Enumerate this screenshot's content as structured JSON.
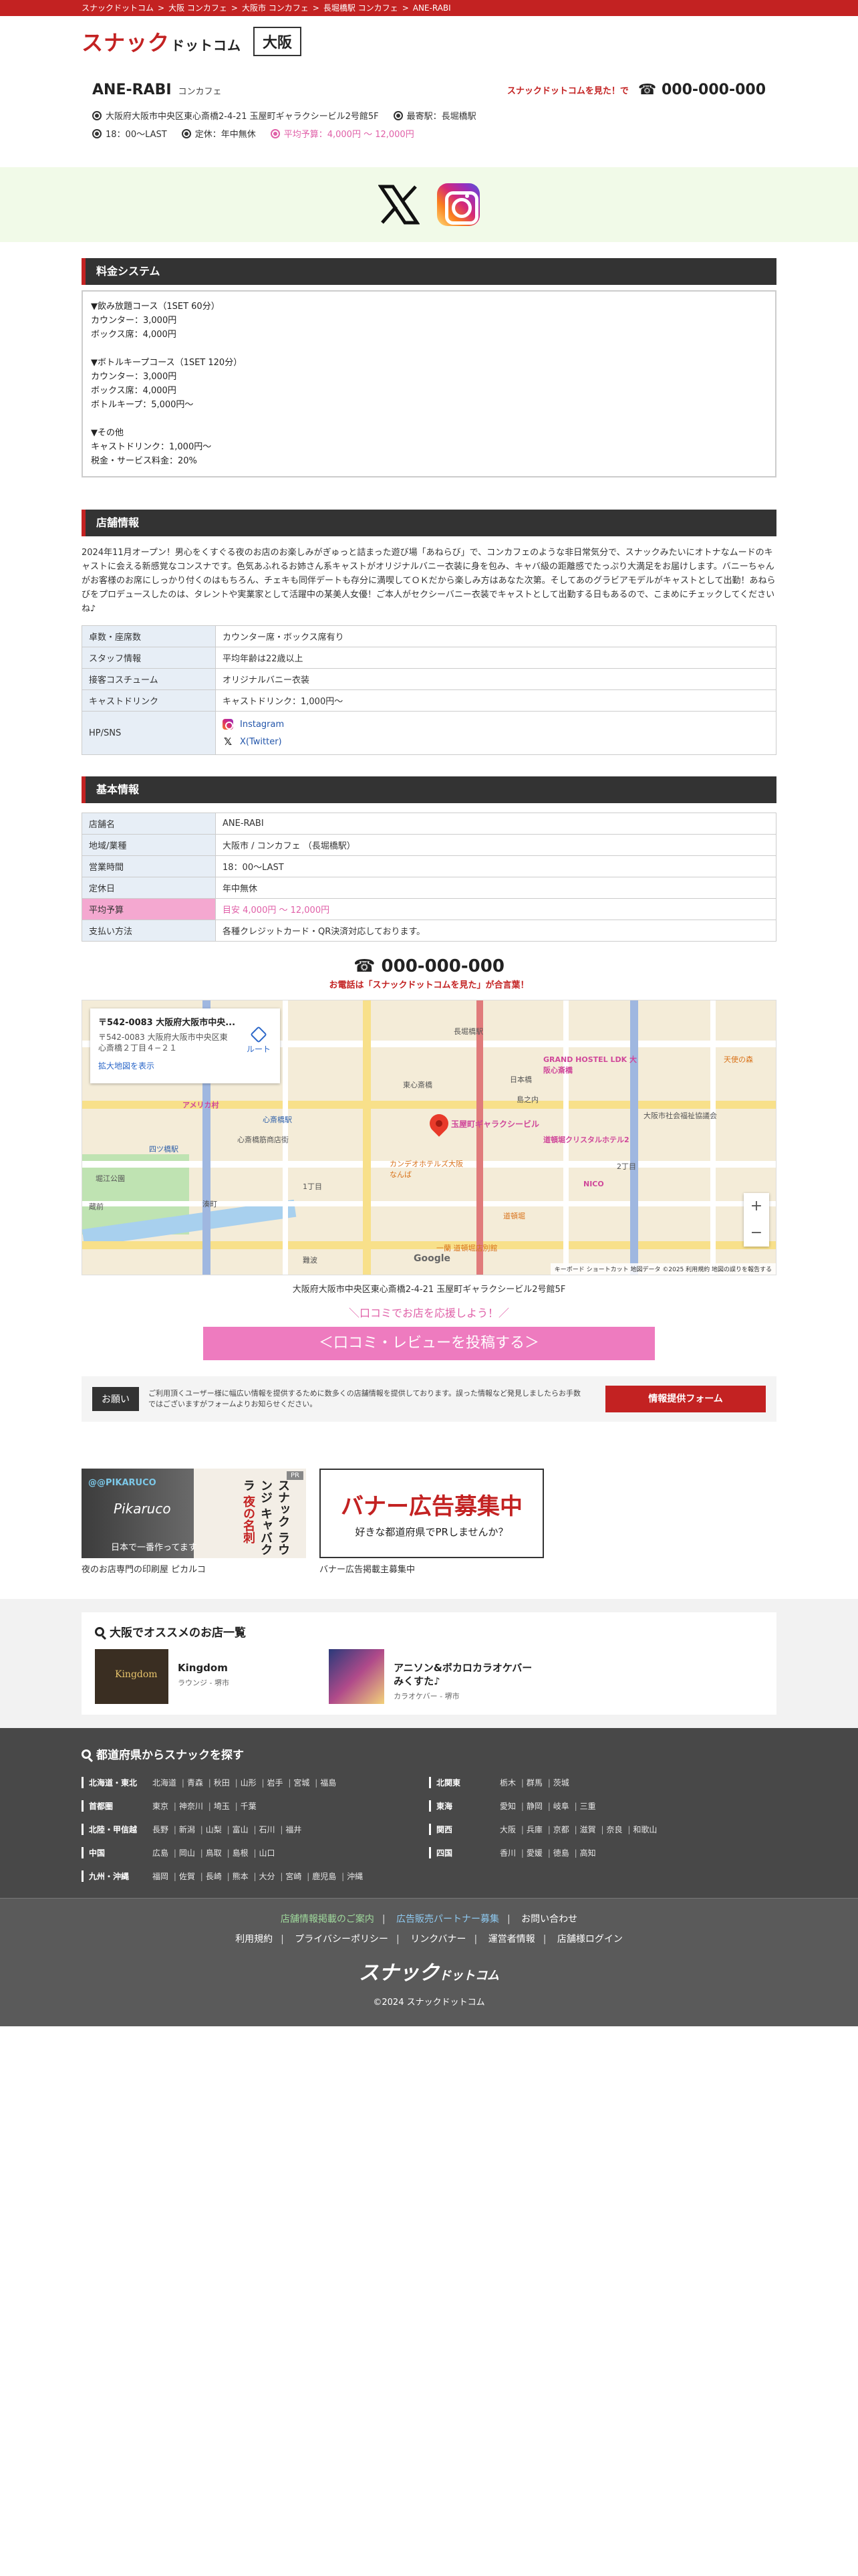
{
  "breadcrumb": [
    "スナックドットコム",
    ">",
    "大阪 コンカフェ",
    ">",
    "大阪市 コンカフェ",
    ">",
    "長堀橋駅 コンカフェ",
    ">",
    "ANE-RABI"
  ],
  "header": {
    "logo_main": "スナック",
    "logo_sub": "ドットコム",
    "area": "大阪"
  },
  "store": {
    "name": "ANE-RABI",
    "genre": "コンカフェ",
    "tel_note": "スナックドットコムを見た！で",
    "tel": "☎ 000-000-000",
    "address": "大阪府大阪市中央区東心斎橋2-4-21 玉屋町ギャラクシービル2号館5F",
    "station": "最寄駅：長堀橋駅",
    "hours": "18：00〜LAST",
    "holiday": "定休：年中無休",
    "budget": "平均予算：4,000円 〜 12,000円"
  },
  "sns": {
    "x_icon": "x-logo-icon",
    "ig_icon": "instagram-logo-icon"
  },
  "price": {
    "title": "料金システム",
    "text": "▼飲み放題コース（1SET 60分）\nカウンター：3,000円\nボックス席：4,000円\n\n▼ボトルキープコース（1SET 120分）\nカウンター：3,000円\nボックス席：4,000円\nボトルキープ：5,000円〜\n\n▼その他\nキャストドリンク：1,000円〜\n税金・サービス料金：20%"
  },
  "shop": {
    "title": "店舗情報",
    "intro": "2024年11月オープン！男心をくすぐる夜のお店のお楽しみがぎゅっと詰まった遊び場「あねらび」で、コンカフェのような非日常気分で、スナックみたいにオトナなムードのキャストに会える新感覚なコンスナです。色気あふれるお姉さん系キャストがオリジナルバニー衣装に身を包み、キャバ級の距離感でたっぷり大満足をお届けします。バニーちゃんがお客様のお席にしっかり付くのはもちろん、チェキも同伴デートも存分に満喫してＯＫだから楽しみ方はあなた次第。そしてあのグラビアモデルがキャストとして出勤！あねらびをプロデュースしたのは、タレントや実業家として活躍中の某美人女優！ご本人がセクシーバニー衣装でキャストとして出勤する日もあるので、こまめにチェックしてくださいね♪",
    "rows": [
      {
        "k": "卓数・座席数",
        "v": "カウンター席・ボックス席有り"
      },
      {
        "k": "スタッフ情報",
        "v": "平均年齢は22歳以上"
      },
      {
        "k": "接客コスチューム",
        "v": "オリジナルバニー衣装"
      },
      {
        "k": "キャストドリンク",
        "v": "キャストドリンク：1,000円〜"
      }
    ],
    "sns_label": "HP/SNS",
    "instagram": "Instagram",
    "twitter": "X(Twitter)"
  },
  "basic": {
    "title": "基本情報",
    "rows": [
      {
        "k": "店舗名",
        "v": "ANE-RABI"
      },
      {
        "k": "地域/業種",
        "v": "大阪市 / コンカフェ （長堀橋駅）"
      },
      {
        "k": "営業時間",
        "v": "18：00〜LAST"
      },
      {
        "k": "定休日",
        "v": "年中無休"
      },
      {
        "k": "平均予算",
        "v": "目安 4,000円 〜 12,000円"
      },
      {
        "k": "支払い方法",
        "v": "各種クレジットカード・QR決済対応しております。"
      }
    ]
  },
  "tel_block": {
    "num": "☎ 000-000-000",
    "note": "お電話は「スナックドットコムを見た」が合言葉！"
  },
  "map": {
    "card_title": "〒542-0083 大阪府大阪市中央...",
    "card_addr": "〒542-0083 大阪府大阪市中央区東心斎橋２丁目４−２１",
    "card_link": "拡大地図を表示",
    "route": "ルート",
    "pin_label": "玉屋町ギャラクシービル",
    "labels": [
      "長堀橋駅",
      "GRAND HOSTEL LDK 大阪心斎橋",
      "東心斎橋",
      "心斎橋筋商店街",
      "道頓堀クリスタルホテル2",
      "カンデオホテルズ大阪なんば",
      "NICO",
      "アメリカ村",
      "心斎橋駅",
      "四ツ橋駅",
      "日本橋",
      "堀江公園",
      "蔵前",
      "湊町",
      "島之内",
      "1丁目",
      "2丁目",
      "大阪市社会福祉協議会",
      "天使の森",
      "一蘭 道頓堀店別館",
      "難波",
      "道頓堀"
    ],
    "google": "Google",
    "footer": "キーボード ショートカット  地図データ ©2025  利用規約  地図の誤りを報告する",
    "zoom_in": "+",
    "zoom_out": "−",
    "address": "大阪府大阪市中央区東心斎橋2-4-21 玉屋町ギャラクシービル2号館5F"
  },
  "review": {
    "lead": "＼口コミでお店を応援しよう！／",
    "button": "＜口コミ・レビューを投稿する＞"
  },
  "request": {
    "tag": "お願い",
    "text": "ご利用頂くユーザー様に幅広い情報を提供するために数多くの店舗情報を提供しております。誤った情報など発見しましたらお手数ではございますがフォームよりお知らせください。",
    "button": "情報提供フォーム"
  },
  "banners": [
    {
      "caption": "夜のお店専門の印刷屋 ピカルコ",
      "pr": "PR",
      "name": "@@PIKARUCO",
      "logo": "Pikaruco",
      "catch": "日本で一番作ってます",
      "vert1": "スナック",
      "vert2": "ラウンジ",
      "vert3": "キャバクラ",
      "vert4": "夜の名刺"
    },
    {
      "caption": "バナー広告掲載主募集中",
      "title": "バナー広告募集中",
      "sub": "好きな都道府県でPRしませんか？"
    }
  ],
  "recommend": {
    "title": "大阪でオススメのお店一覧",
    "items": [
      {
        "name": "Kingdom",
        "genre": "ラウンジ - 堺市"
      },
      {
        "name": "アニソン&ボカロカラオケバー みくすた♪",
        "genre": "カラオケバー - 堺市"
      }
    ]
  },
  "prefectures": {
    "title": "都道府県からスナックを探す",
    "regions": [
      {
        "name": "北海道・東北",
        "list": [
          "北海道",
          "青森",
          "秋田",
          "山形",
          "岩手",
          "宮城",
          "福島"
        ]
      },
      {
        "name": "北関東",
        "list": [
          "栃木",
          "群馬",
          "茨城"
        ]
      },
      {
        "name": "首都圏",
        "list": [
          "東京",
          "神奈川",
          "埼玉",
          "千葉"
        ]
      },
      {
        "name": "東海",
        "list": [
          "愛知",
          "静岡",
          "岐阜",
          "三重"
        ]
      },
      {
        "name": "北陸・甲信越",
        "list": [
          "長野",
          "新潟",
          "山梨",
          "富山",
          "石川",
          "福井"
        ]
      },
      {
        "name": "関西",
        "list": [
          "大阪",
          "兵庫",
          "京都",
          "滋賀",
          "奈良",
          "和歌山"
        ]
      },
      {
        "name": "中国",
        "list": [
          "広島",
          "岡山",
          "鳥取",
          "島根",
          "山口"
        ]
      },
      {
        "name": "四国",
        "list": [
          "香川",
          "愛媛",
          "徳島",
          "高知"
        ]
      },
      {
        "name": "九州・沖縄",
        "list": [
          "福岡",
          "佐賀",
          "長崎",
          "熊本",
          "大分",
          "宮崎",
          "鹿児島",
          "沖縄"
        ]
      }
    ]
  },
  "footer": {
    "links1": [
      "店舗情報掲載のご案内",
      "広告販売パートナー募集",
      "お問い合わせ"
    ],
    "links2": [
      "利用規約",
      "プライバシーポリシー",
      "リンクバナー",
      "運営者情報",
      "店舗様ログイン"
    ],
    "logo_main": "スナック",
    "logo_sub": "ドットコム",
    "copyright": "©2024 スナックドットコム"
  },
  "colors": {
    "brand": "#c32222",
    "pink": "#e060a8",
    "dark": "#333333"
  }
}
